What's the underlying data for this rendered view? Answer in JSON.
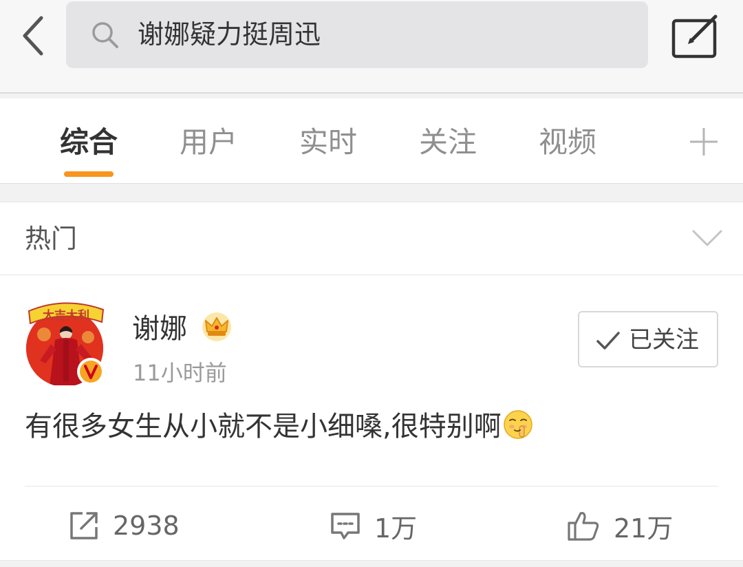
{
  "search": {
    "query": "谢娜疑力挺周迅"
  },
  "tabs": [
    {
      "label": "综合",
      "active": true
    },
    {
      "label": "用户",
      "active": false
    },
    {
      "label": "实时",
      "active": false
    },
    {
      "label": "关注",
      "active": false
    },
    {
      "label": "视频",
      "active": false
    }
  ],
  "section": {
    "title": "热门"
  },
  "post": {
    "username": "谢娜",
    "time": "11小时前",
    "follow_label": "已关注",
    "text": "有很多女生从小就不是小细嗓,很特别啊",
    "avatar_banner_text": "大吉大利",
    "actions": {
      "repost_count": "2938",
      "comment_count": "1万",
      "like_count": "21万"
    }
  },
  "colors": {
    "accent_orange": "#f7951d",
    "avatar_red": "#d9281c",
    "crown_gold": "#f5b731"
  },
  "icons": {
    "back": "chevron-left-icon",
    "search": "search-icon",
    "compose": "compose-icon",
    "add_tab": "plus-icon",
    "expand": "chevron-down-icon",
    "member": "crown-icon",
    "verified": "verified-v-icon",
    "followed": "checkmark-icon",
    "emoji": "shush-emoji-icon",
    "repost": "repost-icon",
    "comment": "comment-icon",
    "like": "thumbs-up-icon"
  }
}
